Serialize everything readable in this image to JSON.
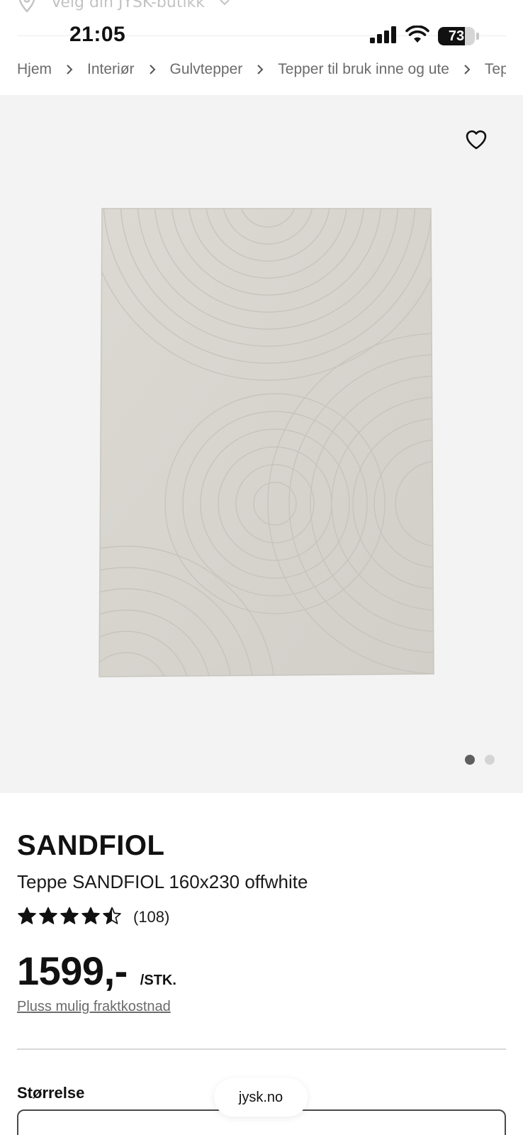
{
  "status_bar": {
    "time": "21:05",
    "battery_percent": "73",
    "battery_level": 0.73
  },
  "store_selector": {
    "label": "Velg din JYSK-butikk",
    "icon": "location-pin-icon"
  },
  "breadcrumb": {
    "items": [
      "Hjem",
      "Interiør",
      "Gulvtepper",
      "Tepper til bruk inne og ute",
      "Tepper"
    ]
  },
  "gallery": {
    "favorite_icon": "heart-icon",
    "image_count": 2,
    "active_index": 0
  },
  "product": {
    "brand": "SANDFIOL",
    "title": "Teppe SANDFIOL 160x230 offwhite",
    "rating": {
      "score": 4.5,
      "max": 5,
      "count_label": "(108)"
    },
    "price": "1599,-",
    "unit": "/STK.",
    "shipping_link": "Pluss mulig fraktkostnad",
    "size_label": "Størrelse"
  },
  "browser": {
    "url": "jysk.no"
  }
}
